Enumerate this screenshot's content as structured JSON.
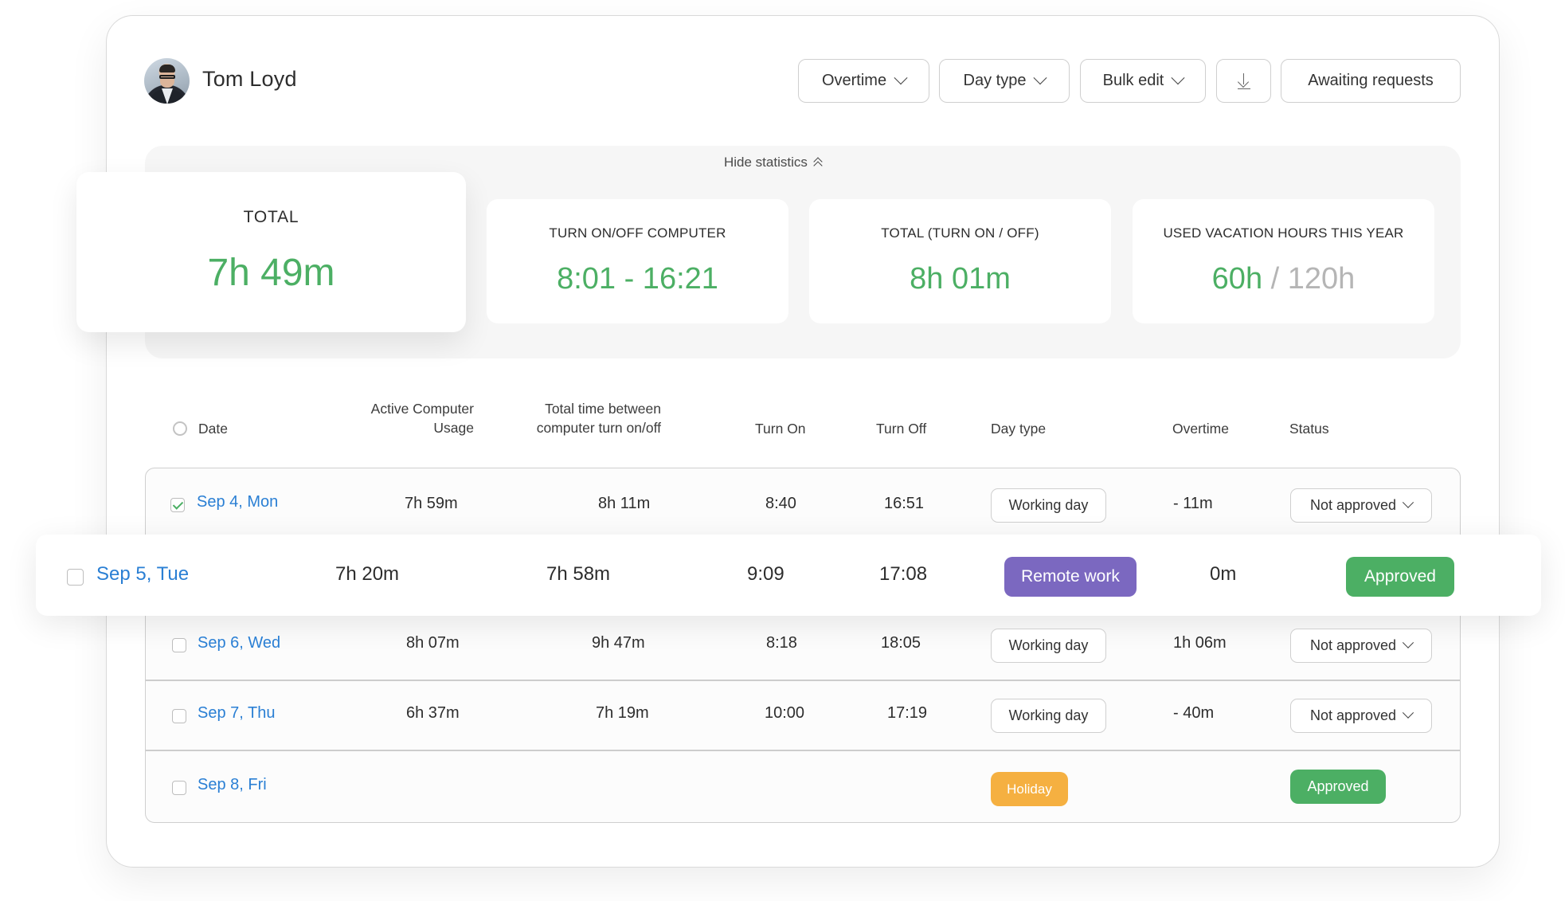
{
  "user": {
    "name": "Tom Loyd",
    "avatar_icon": "user-photo"
  },
  "toolbar": {
    "overtime_label": "Overtime",
    "day_type_label": "Day type",
    "bulk_edit_label": "Bulk edit",
    "download_icon": "download-icon",
    "awaiting_label": "Awaiting requests"
  },
  "stats": {
    "toggle_label": "Hide statistics",
    "cards": [
      {
        "label": "TOTAL",
        "value": "7h 49m"
      },
      {
        "label": "TURN ON/OFF COMPUTER",
        "value": "8:01 - 16:21"
      },
      {
        "label": "TOTAL (TURN ON / OFF)",
        "value": "8h 01m"
      },
      {
        "label": "USED VACATION HOURS THIS YEAR",
        "value_used": "60h",
        "separator": "/",
        "value_total": "120h"
      }
    ]
  },
  "table": {
    "headers": {
      "date": "Date",
      "active_line1": "Active Computer",
      "active_line2": "Usage",
      "between_line1": "Total time between",
      "between_line2": "computer turn on/off",
      "turn_on": "Turn On",
      "turn_off": "Turn Off",
      "day_type": "Day type",
      "overtime": "Overtime",
      "status": "Status"
    },
    "rows": [
      {
        "date": "Sep 4, Mon",
        "checked": true,
        "active": "7h 59m",
        "between": "8h 11m",
        "turn_on": "8:40",
        "turn_off": "16:51",
        "day_type": "Working day",
        "overtime": "- 11m",
        "status": "Not approved"
      },
      {
        "date": "Sep 5, Tue",
        "checked": false,
        "active": "7h 20m",
        "between": "7h 58m",
        "turn_on": "9:09",
        "turn_off": "17:08",
        "day_type": "Remote work",
        "overtime": "0m",
        "status": "Approved"
      },
      {
        "date": "Sep 6, Wed",
        "checked": false,
        "active": "8h 07m",
        "between": "9h 47m",
        "turn_on": "8:18",
        "turn_off": "18:05",
        "day_type": "Working day",
        "overtime": "1h 06m",
        "status": "Not approved"
      },
      {
        "date": "Sep 7, Thu",
        "checked": false,
        "active": "6h 37m",
        "between": "7h 19m",
        "turn_on": "10:00",
        "turn_off": "17:19",
        "day_type": "Working day",
        "overtime": "- 40m",
        "status": "Not approved"
      },
      {
        "date": "Sep 8, Fri",
        "checked": false,
        "active": "",
        "between": "",
        "turn_on": "",
        "turn_off": "",
        "day_type": "Holiday",
        "overtime": "",
        "status": "Approved"
      }
    ]
  },
  "colors": {
    "accent_green": "#4caf64",
    "date_blue": "#2a7fd4",
    "remote_purple": "#7b68c0",
    "holiday_orange": "#f5b041",
    "approved_green": "#4caf64",
    "muted_gray": "#b5b5b5"
  }
}
